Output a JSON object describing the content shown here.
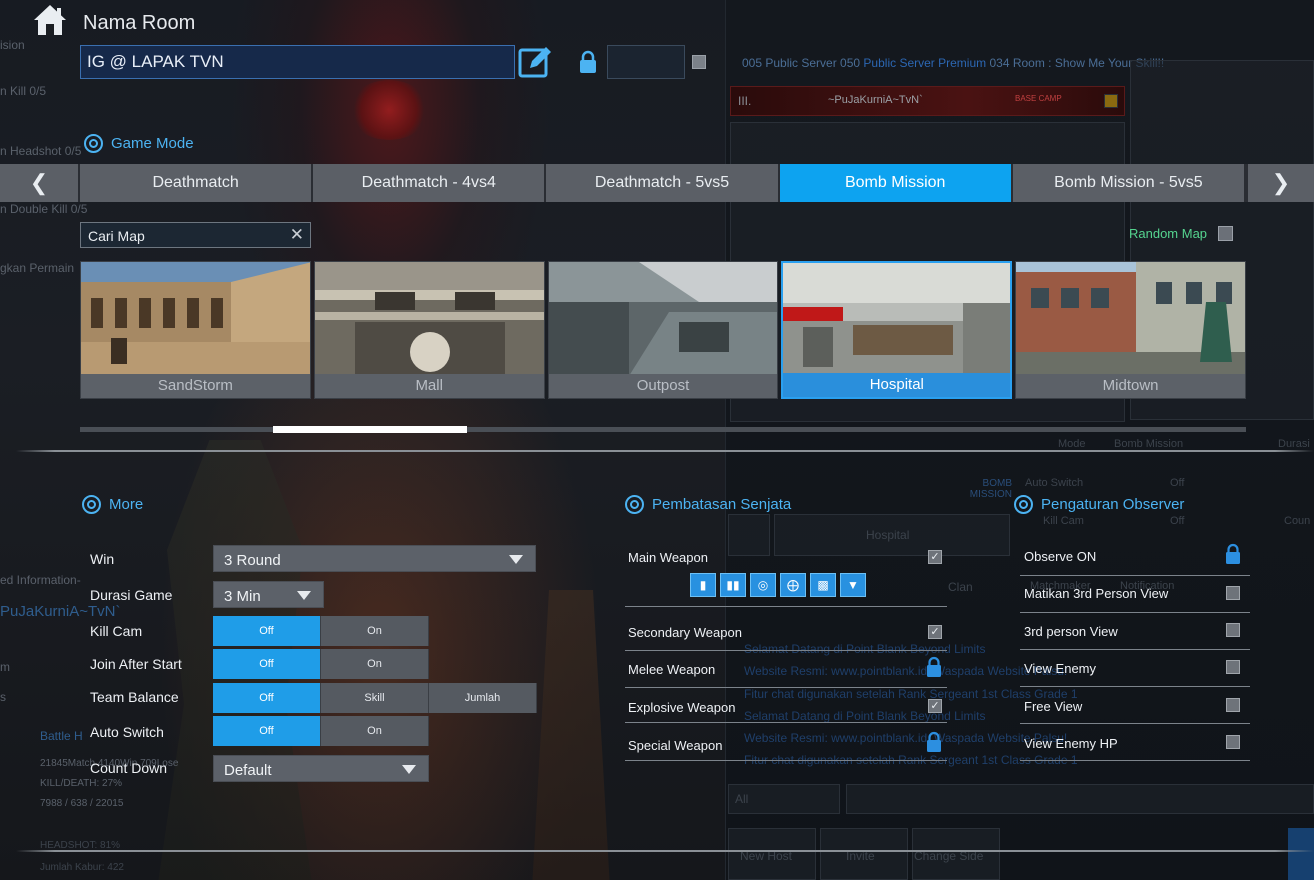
{
  "window": {
    "title": "Nama Room"
  },
  "room": {
    "name_value": "IG @ LAPAK TVN",
    "password_value": ""
  },
  "game_mode": {
    "header": "Game Mode",
    "prev_icon": "chevron-left-icon",
    "next_icon": "chevron-right-icon",
    "tabs": [
      {
        "label": "Deathmatch",
        "active": false
      },
      {
        "label": "Deathmatch - 4vs4",
        "active": false
      },
      {
        "label": "Deathmatch - 5vs5",
        "active": false
      },
      {
        "label": "Bomb Mission",
        "active": true
      },
      {
        "label": "Bomb Mission - 5vs5",
        "active": false
      }
    ]
  },
  "map_search": {
    "placeholder": "Cari Map"
  },
  "random_map": {
    "label": "Random Map",
    "checked": false
  },
  "maps": [
    {
      "name": "SandStorm",
      "selected": false
    },
    {
      "name": "Mall",
      "selected": false
    },
    {
      "name": "Outpost",
      "selected": false
    },
    {
      "name": "Hospital",
      "selected": true
    },
    {
      "name": "Midtown",
      "selected": false
    }
  ],
  "more": {
    "header": "More",
    "win": {
      "label": "Win",
      "value": "3 Round"
    },
    "durasi": {
      "label": "Durasi Game",
      "value": "3 Min"
    },
    "kill_cam": {
      "label": "Kill Cam",
      "options": [
        "Off",
        "On"
      ],
      "selected": "Off"
    },
    "join_after_start": {
      "label": "Join After Start",
      "options": [
        "Off",
        "On"
      ],
      "selected": "Off"
    },
    "team_balance": {
      "label": "Team Balance",
      "options": [
        "Off",
        "Skill",
        "Jumlah"
      ],
      "selected": "Off"
    },
    "auto_switch": {
      "label": "Auto Switch",
      "options": [
        "Off",
        "On"
      ],
      "selected": "Off"
    },
    "count_down": {
      "label": "Count Down",
      "value": "Default"
    }
  },
  "weapons": {
    "header": "Pembatasan Senjata",
    "items": [
      {
        "label": "Main Weapon",
        "state": "checked"
      },
      {
        "label": "Secondary Weapon",
        "state": "checked"
      },
      {
        "label": "Melee Weapon",
        "state": "locked"
      },
      {
        "label": "Explosive Weapon",
        "state": "checked"
      },
      {
        "label": "Special Weapon",
        "state": "locked"
      }
    ],
    "main_weapon_icons": [
      "bullet-icon",
      "ammo-icon",
      "target-icon",
      "crosshair-icon",
      "grenade-icon",
      "shield-icon"
    ]
  },
  "observer": {
    "header": "Pengaturan Observer",
    "items": [
      {
        "label": "Observe ON",
        "state": "locked"
      },
      {
        "label": "Matikan 3rd Person View",
        "state": "unchecked"
      },
      {
        "label": "3rd person View",
        "state": "unchecked"
      },
      {
        "label": "View Enemy",
        "state": "unchecked"
      },
      {
        "label": "Free View",
        "state": "unchecked"
      },
      {
        "label": "View Enemy HP",
        "state": "unchecked"
      }
    ]
  },
  "background": {
    "left_texts": [
      "ision",
      "n Kill 0/5",
      "n Headshot 0/5",
      "n Double Kill 0/5",
      "gkan Permain",
      "ed Information-",
      "PuJaKurniA~TvN`",
      "m",
      "s",
      "21845Match 4140Win 709Lose",
      "KILL/DEATH: 27%",
      "7988 / 638 / 22015",
      "HEADSHOT: 81%",
      "Jumlah Kabur: 422",
      "Battle H"
    ],
    "server_line": [
      "005 Public Server 050",
      "Public Server Premium",
      "034 Room : Show Me Your Skill!!"
    ],
    "player_rank": "III.",
    "player_name": "~PuJaKurniA~TvN`",
    "camp_label": "BASE CAMP",
    "info_rows": [
      {
        "label": "Mode",
        "value": "Bomb Mission",
        "extra": "Durasi"
      },
      {
        "label": "Auto Switch",
        "value": "Off"
      },
      {
        "label": "Kill Cam",
        "value": "Off",
        "extra": "Coun"
      }
    ],
    "bomb_label": "BOMB MISSION",
    "map_select": "Hospital",
    "buttons": [
      "Clan",
      "Matchmaker",
      "Notification"
    ],
    "chat": [
      "Selamat Datang di Point Blank Beyond Limits",
      "Website Resmi: www.pointblank.id ,Waspada Website Palsu!",
      "Fitur chat digunakan setelah Rank Sergeant 1st Class Grade 1",
      "Selamat Datang di Point Blank Beyond Limits",
      "Website Resmi: www.pointblank.id ,Waspada Website Palsu!",
      "Fitur chat digunakan setelah Rank Sergeant 1st Class Grade 1"
    ],
    "chat_filter": "All",
    "bottom_buttons": [
      "New Host",
      "Invite",
      "Change Side"
    ]
  },
  "colors": {
    "accent": "#0da3f0",
    "section": "#4cb3f2",
    "random": "#55d48f",
    "toggle_on": "#1f9de8"
  }
}
